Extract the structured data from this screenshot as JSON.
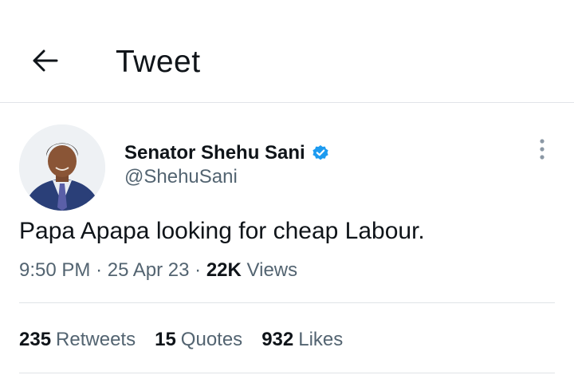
{
  "header": {
    "title": "Tweet",
    "back_icon": "arrow-left-icon"
  },
  "tweet": {
    "author_name": "Senator Shehu Sani",
    "verified": true,
    "verified_color": "#1d9bf0",
    "handle": "@ShehuSani",
    "text": "Papa Apapa looking for cheap Labour.",
    "time": "9:50 PM",
    "date": "25 Apr 23",
    "views_count": "22K",
    "views_label": "Views",
    "separator": "·"
  },
  "stats": {
    "retweets_count": "235",
    "retweets_label": "Retweets",
    "quotes_count": "15",
    "quotes_label": "Quotes",
    "likes_count": "932",
    "likes_label": "Likes"
  }
}
